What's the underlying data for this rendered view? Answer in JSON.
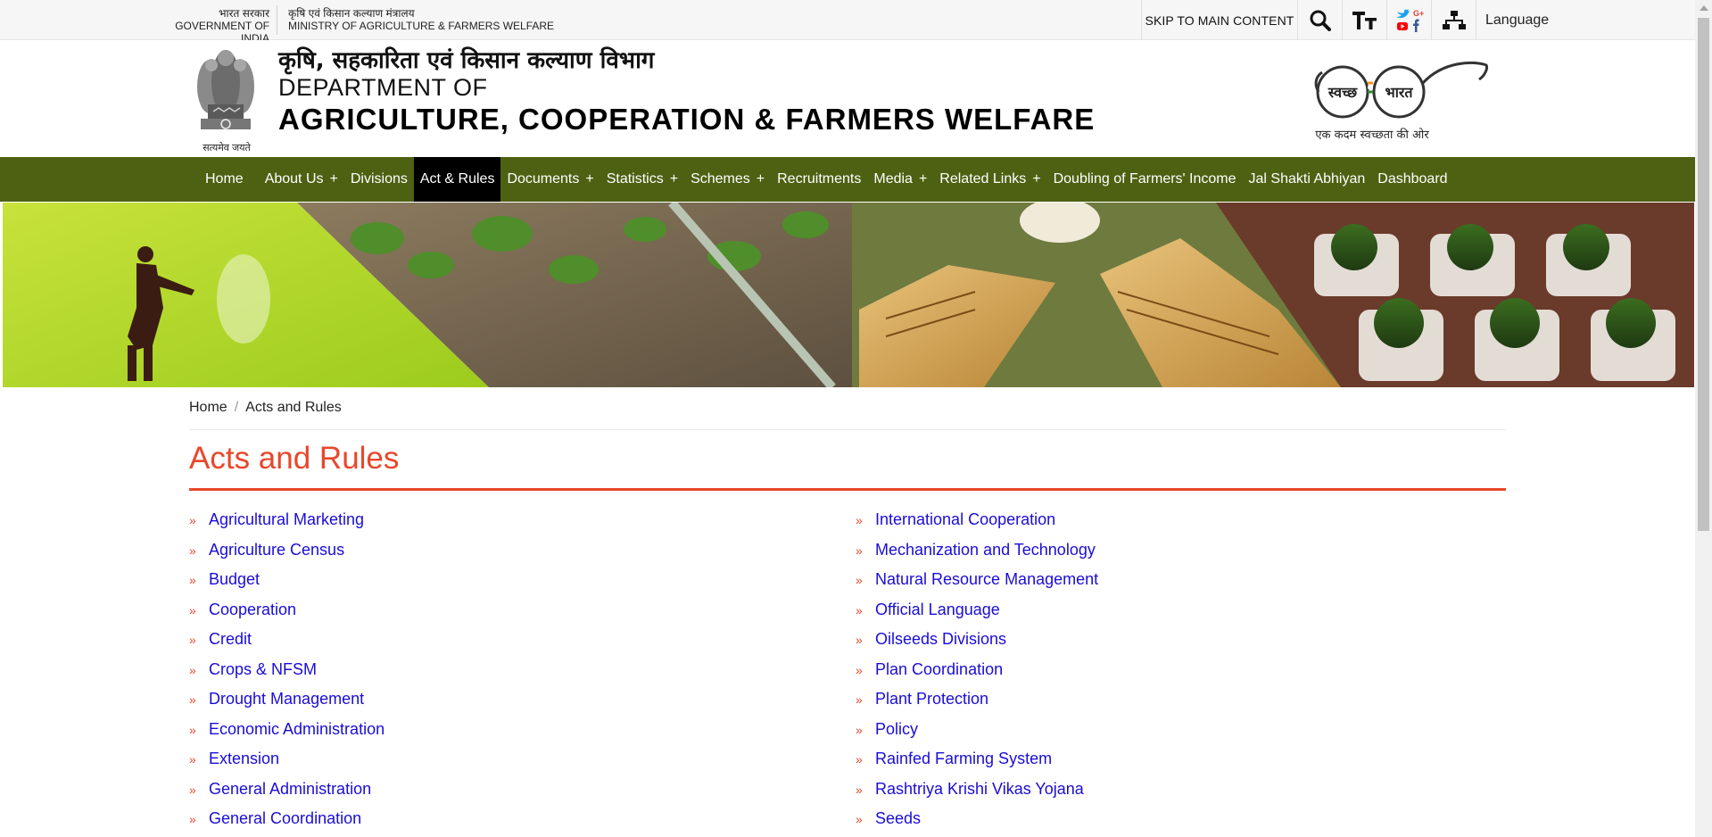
{
  "topbar": {
    "gov_hindi": "भारत सरकार",
    "gov_english": "GOVERNMENT OF INDIA",
    "ministry_hindi": "कृषि एवं किसान कल्याण मंत्रालय",
    "ministry_english": "MINISTRY OF AGRICULTURE & FARMERS WELFARE",
    "skip_label": "SKIP TO MAIN CONTENT",
    "language_label": "Language",
    "icons": [
      "search-icon",
      "text-size-icon",
      "social-media-icon",
      "sitemap-icon"
    ]
  },
  "header": {
    "emblem_motto": "सत्यमेव जयते",
    "dept_hindi": "कृषि, सहकारिता एवं किसान कल्याण विभाग",
    "dept_line1": "DEPARTMENT OF",
    "dept_line2": "AGRICULTURE, COOPERATION & FARMERS WELFARE",
    "swachh_word1": "स्वच्छ",
    "swachh_word2": "भारत",
    "swachh_tagline": "एक कदम स्वच्छता की ओर"
  },
  "nav": {
    "items": [
      {
        "label": "Home",
        "plus": ""
      },
      {
        "label": "About Us",
        "plus": "+"
      },
      {
        "label": "Divisions",
        "plus": ""
      },
      {
        "label": "Act & Rules",
        "plus": ""
      },
      {
        "label": "Documents",
        "plus": "+"
      },
      {
        "label": "Statistics",
        "plus": "+"
      },
      {
        "label": "Schemes",
        "plus": "+"
      },
      {
        "label": "Recruitments",
        "plus": ""
      },
      {
        "label": "Media",
        "plus": "+"
      },
      {
        "label": "Related Links",
        "plus": "+"
      },
      {
        "label": "Doubling of Farmers' Income",
        "plus": ""
      },
      {
        "label": "Jal Shakti Abhiyan",
        "plus": ""
      },
      {
        "label": "Dashboard",
        "plus": ""
      }
    ],
    "active_index": 3
  },
  "breadcrumb": {
    "home": "Home",
    "separator": "/",
    "current": "Acts and Rules"
  },
  "main": {
    "title": "Acts and Rules",
    "left_links": [
      "Agricultural Marketing",
      "Agriculture Census",
      "Budget",
      "Cooperation",
      "Credit",
      "Crops & NFSM",
      "Drought Management",
      "Economic Administration",
      "Extension",
      "General Administration",
      "General Coordination"
    ],
    "right_links": [
      "International Cooperation",
      "Mechanization and Technology",
      "Natural Resource Management",
      "Official Language",
      "Oilseeds Divisions",
      "Plan Coordination",
      "Plant Protection",
      "Policy",
      "Rainfed Farming System",
      "Rashtriya Krishi Vikas Yojana",
      "Seeds"
    ],
    "bullet_glyph": "»"
  },
  "colors": {
    "nav_bg": "#4e6112",
    "accent": "#e8472b",
    "link": "#1a0dd6",
    "active_nav": "#000000"
  }
}
